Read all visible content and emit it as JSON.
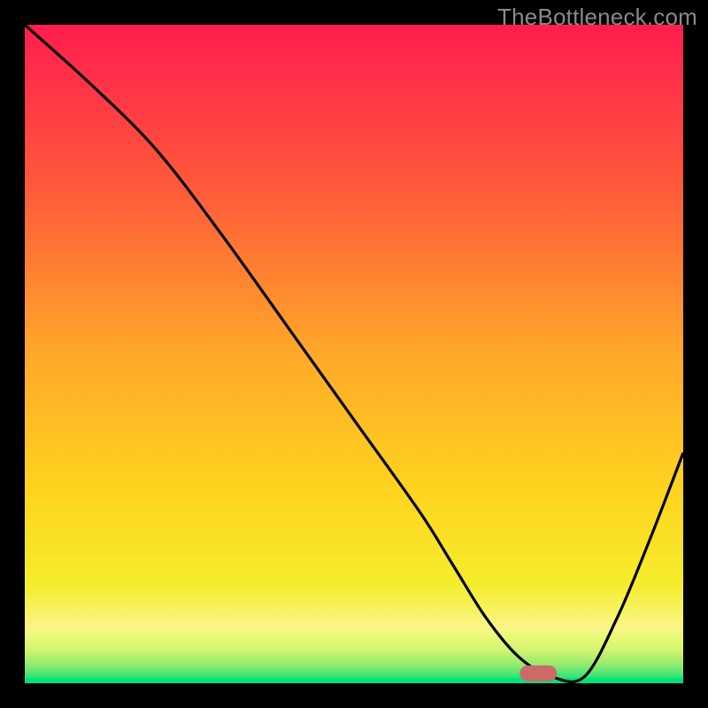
{
  "watermark": "TheBottleneck.com",
  "chart_data": {
    "type": "line",
    "title": "",
    "xlabel": "",
    "ylabel": "",
    "xlim": [
      0,
      100
    ],
    "ylim": [
      0,
      100
    ],
    "x": [
      0,
      10,
      20,
      30,
      40,
      50,
      60,
      65,
      70,
      75,
      80,
      85,
      90,
      95,
      100
    ],
    "values": [
      100,
      91,
      81,
      68,
      54,
      40,
      26,
      18,
      10,
      4,
      1,
      1,
      10,
      22,
      35
    ],
    "annotations": [
      {
        "type": "gradient_band",
        "y_range": [
          0,
          8
        ],
        "colors": [
          "#00e37a",
          "#e9f97a"
        ]
      }
    ],
    "marker": {
      "x": 78,
      "y": 1.5,
      "shape": "capsule",
      "color": "#cc6a6a"
    },
    "background_gradient": {
      "stops": [
        {
          "pos": 0.0,
          "color": "#ff1d4f"
        },
        {
          "pos": 0.25,
          "color": "#ff5a3a"
        },
        {
          "pos": 0.5,
          "color": "#ffa829"
        },
        {
          "pos": 0.7,
          "color": "#ffd21f"
        },
        {
          "pos": 0.85,
          "color": "#f5ed2b"
        },
        {
          "pos": 1.0,
          "color": "#ffffff"
        }
      ]
    }
  }
}
